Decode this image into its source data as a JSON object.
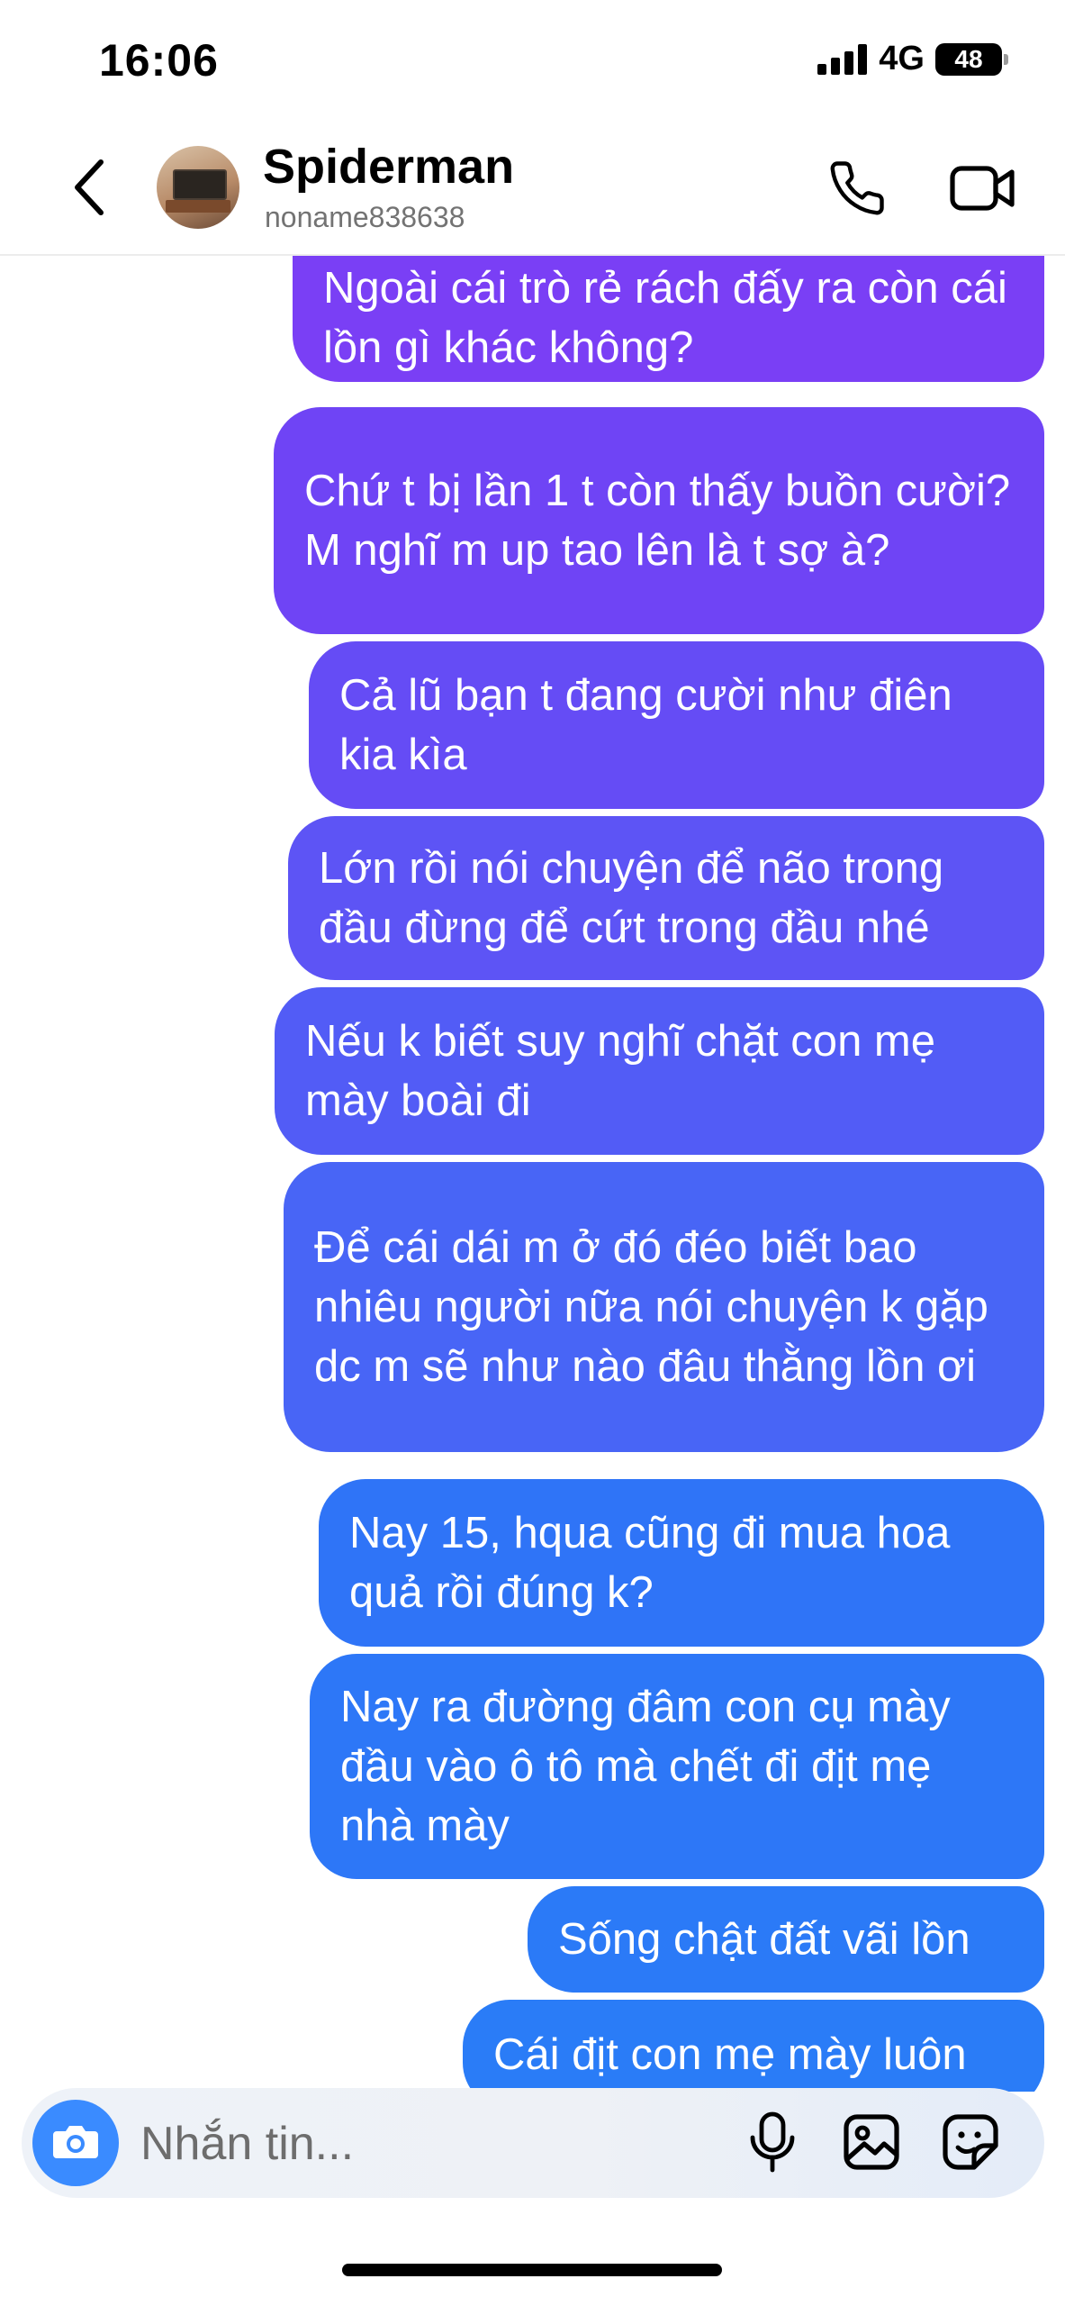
{
  "status_bar": {
    "time": "16:06",
    "network": "4G",
    "battery": "48"
  },
  "header": {
    "contact_name": "Spiderman",
    "username": "noname838638"
  },
  "messages": [
    {
      "text": "Ngoài cái trò rẻ rách đấy ra còn cái lồn gì khác không?",
      "color": "#7a3ff5"
    },
    {
      "text": "Chứ t bị lần 1 t còn thấy buồn cười? M nghĩ m up tao lên là t sợ à?",
      "color": "#6f44f5"
    },
    {
      "text": "Cả lũ bạn t đang cười như điên kia kìa",
      "color": "#654cf5"
    },
    {
      "text": "Lớn rồi nói chuyện để não trong đầu đừng để cứt trong đầu nhé",
      "color": "#5d54f5"
    },
    {
      "text": "Nếu k biết suy nghĩ chặt con mẹ mày boài đi",
      "color": "#525cf6"
    },
    {
      "text": "Để cái dái m ở đó đéo biết bao nhiêu người nữa nói chuyện k gặp dc m sẽ như nào đâu thằng lồn ơi",
      "color": "#4865f6"
    },
    {
      "text": "Nay 15, hqua cũng đi mua hoa quả rồi đúng k?",
      "color": "#2f74f7"
    },
    {
      "text": "Nay ra đường đâm con cụ mày đầu vào ô tô mà chết đi địt mẹ nhà mày",
      "color": "#2d77f7"
    },
    {
      "text": "Sống chật đất vãi lồn",
      "color": "#2b7af7"
    },
    {
      "text": "Cái địt con mẹ mày luôn",
      "color": "#2a7cf7"
    }
  ],
  "composer": {
    "placeholder": "Nhắn tin..."
  },
  "icons": {
    "back": "chevron-left-icon",
    "call": "phone-icon",
    "video": "video-camera-icon",
    "camera": "camera-icon",
    "mic": "microphone-icon",
    "gallery": "image-icon",
    "sticker": "sticker-icon"
  },
  "colors": {
    "camera_button": "#3a8bff",
    "placeholder_text": "#6d6d6d"
  }
}
